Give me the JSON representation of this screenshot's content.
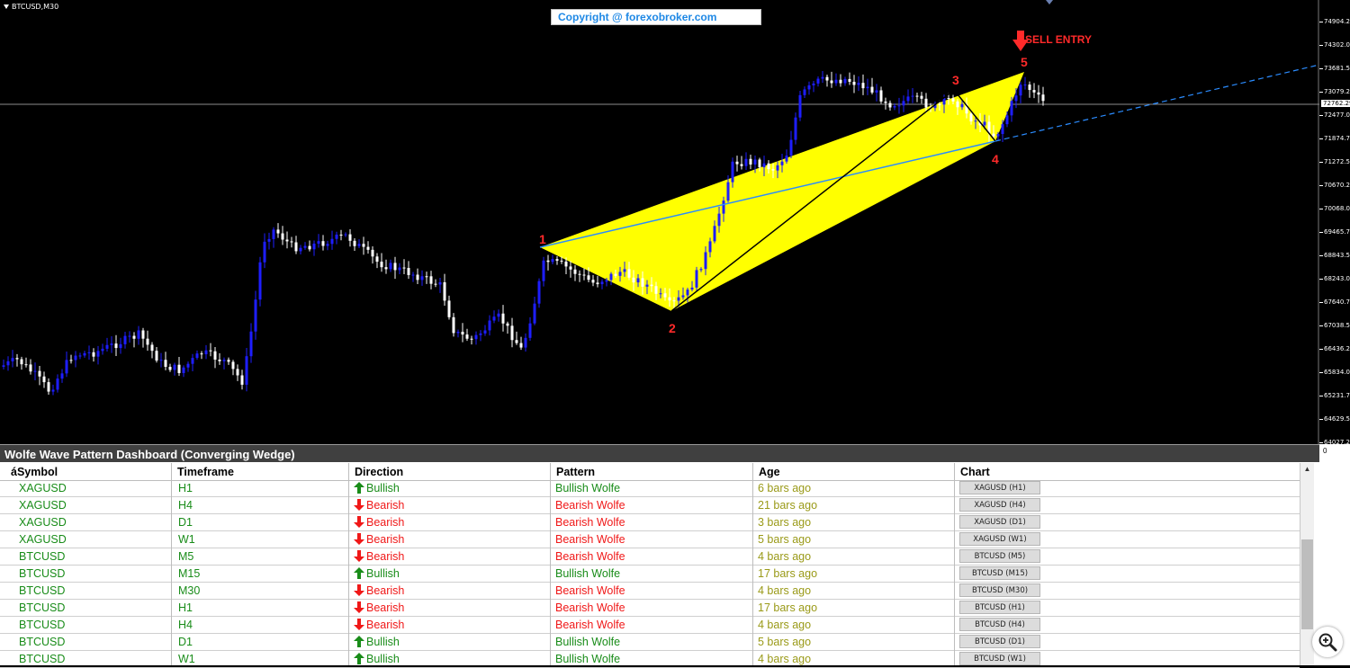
{
  "chart": {
    "symbol_label": "BTCUSD,M30",
    "copyright": "Copyright @ forexobroker.com",
    "current_price": "72762.29",
    "price_axis": [
      "74904.25",
      "74302.00",
      "73681.50",
      "73079.25",
      "72477.00",
      "71874.75",
      "71272.50",
      "70670.25",
      "70068.00",
      "69465.75",
      "68843.50",
      "68243.00",
      "67640.75",
      "67038.50",
      "66436.25",
      "65834.00",
      "65231.75",
      "64629.50",
      "64027.25"
    ],
    "wave_labels": [
      "1",
      "2",
      "3",
      "4",
      "5"
    ],
    "sell_entry": "SELL ENTRY",
    "colors": {
      "bull_candle": "#1e1eff",
      "bear_candle": "#ffffff",
      "wedge_fill": "#ffff00",
      "target_line": "#2b8cff",
      "wave_label": "#ff2a2a",
      "background": "#000000"
    }
  },
  "dashboard": {
    "title": "Wolfe Wave Pattern Dashboard (Converging Wedge)",
    "columns": [
      "áSymbol",
      "Timeframe",
      "Direction",
      "Pattern",
      "Age",
      "Chart"
    ],
    "rows": [
      {
        "symbol": "XAGUSD",
        "tf": "H1",
        "dir": "Bullish",
        "pattern": "Bullish Wolfe",
        "age": "6 bars ago",
        "btn": "XAGUSD (H1)"
      },
      {
        "symbol": "XAGUSD",
        "tf": "H4",
        "dir": "Bearish",
        "pattern": "Bearish Wolfe",
        "age": "21 bars ago",
        "btn": "XAGUSD (H4)"
      },
      {
        "symbol": "XAGUSD",
        "tf": "D1",
        "dir": "Bearish",
        "pattern": "Bearish Wolfe",
        "age": "3 bars ago",
        "btn": "XAGUSD (D1)"
      },
      {
        "symbol": "XAGUSD",
        "tf": "W1",
        "dir": "Bearish",
        "pattern": "Bearish Wolfe",
        "age": "5 bars ago",
        "btn": "XAGUSD (W1)"
      },
      {
        "symbol": "BTCUSD",
        "tf": "M5",
        "dir": "Bearish",
        "pattern": "Bearish Wolfe",
        "age": "4 bars ago",
        "btn": "BTCUSD (M5)"
      },
      {
        "symbol": "BTCUSD",
        "tf": "M15",
        "dir": "Bullish",
        "pattern": "Bullish Wolfe",
        "age": "17 bars ago",
        "btn": "BTCUSD (M15)"
      },
      {
        "symbol": "BTCUSD",
        "tf": "M30",
        "dir": "Bearish",
        "pattern": "Bearish Wolfe",
        "age": "4 bars ago",
        "btn": "BTCUSD (M30)"
      },
      {
        "symbol": "BTCUSD",
        "tf": "H1",
        "dir": "Bearish",
        "pattern": "Bearish Wolfe",
        "age": "17 bars ago",
        "btn": "BTCUSD (H1)"
      },
      {
        "symbol": "BTCUSD",
        "tf": "H4",
        "dir": "Bearish",
        "pattern": "Bearish Wolfe",
        "age": "4 bars ago",
        "btn": "BTCUSD (H4)"
      },
      {
        "symbol": "BTCUSD",
        "tf": "D1",
        "dir": "Bullish",
        "pattern": "Bullish Wolfe",
        "age": "5 bars ago",
        "btn": "BTCUSD (D1)"
      },
      {
        "symbol": "BTCUSD",
        "tf": "W1",
        "dir": "Bullish",
        "pattern": "Bullish Wolfe",
        "age": "4 bars ago",
        "btn": "BTCUSD (W1)"
      }
    ],
    "scroll_zero": "0",
    "icons": {
      "zoom": "zoom-in-icon",
      "bull": "arrow-up-icon",
      "bear": "arrow-down-icon"
    }
  }
}
